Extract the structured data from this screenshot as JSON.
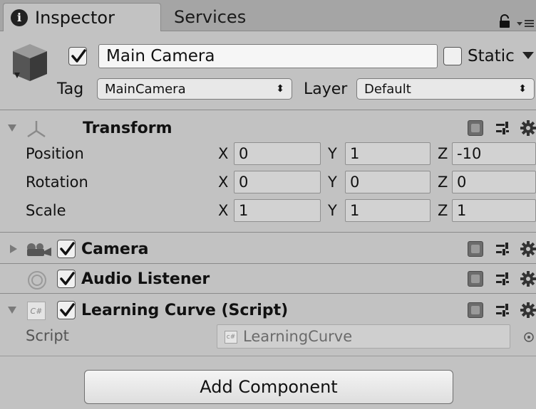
{
  "tabs": [
    {
      "label": "Inspector",
      "icon": "info-icon",
      "active": true
    },
    {
      "label": "Services",
      "active": false
    }
  ],
  "header": {
    "object_name": "Main Camera",
    "active": true,
    "static_label": "Static",
    "static_checked": false,
    "tag_label": "Tag",
    "tag_value": "MainCamera",
    "layer_label": "Layer",
    "layer_value": "Default"
  },
  "transform": {
    "title": "Transform",
    "rows": [
      {
        "label": "Position",
        "x": "0",
        "y": "1",
        "z": "-10"
      },
      {
        "label": "Rotation",
        "x": "0",
        "y": "0",
        "z": "0"
      },
      {
        "label": "Scale",
        "x": "1",
        "y": "1",
        "z": "1"
      }
    ],
    "axes": [
      "X",
      "Y",
      "Z"
    ]
  },
  "components": [
    {
      "title": "Camera",
      "enabled": true,
      "icon": "camera-icon",
      "expanded": false
    },
    {
      "title": "Audio Listener",
      "enabled": true,
      "icon": "audio-listener-icon"
    },
    {
      "title": "Learning Curve (Script)",
      "enabled": true,
      "icon": "cs-script-icon",
      "expanded": true
    }
  ],
  "script": {
    "label": "Script",
    "value": "LearningCurve"
  },
  "add_component_label": "Add Component",
  "colors": {
    "panel_bg": "#c2c2c2",
    "tabbar_bg": "#a5a5a5",
    "field_bg": "#d2d2d2"
  }
}
